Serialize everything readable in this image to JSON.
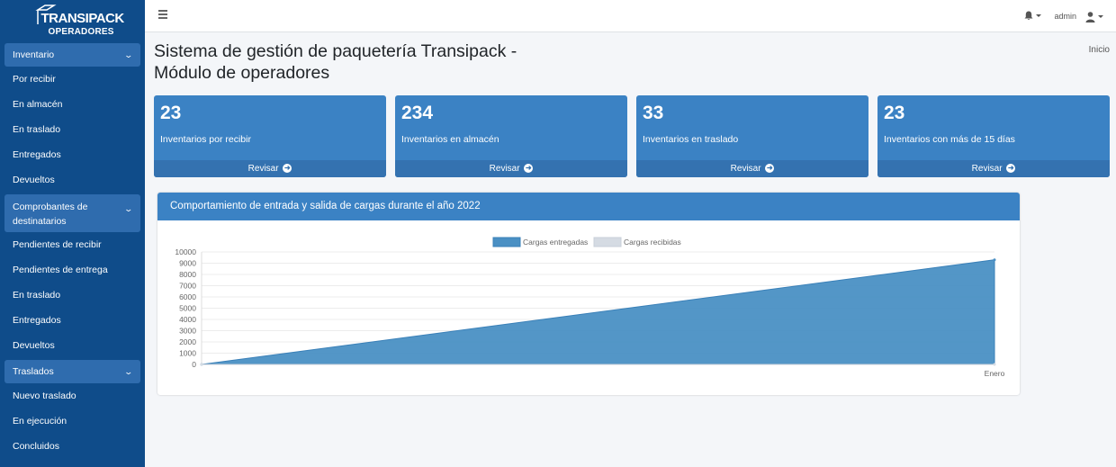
{
  "brand": {
    "line1": "TRANSIPACK",
    "line2": "OPERADORES"
  },
  "sidebar": {
    "sections": [
      {
        "label": "Inventario",
        "items": [
          "Por recibir",
          "En almacén",
          "En traslado",
          "Entregados",
          "Devueltos"
        ]
      },
      {
        "label": "Comprobantes de destinatarios",
        "items": [
          "Pendientes de recibir",
          "Pendientes de entrega",
          "En traslado",
          "Entregados",
          "Devueltos"
        ]
      },
      {
        "label": "Traslados",
        "items": [
          "Nuevo traslado",
          "En ejecución",
          "Concluidos"
        ]
      }
    ]
  },
  "topbar": {
    "user": "admin"
  },
  "page": {
    "title": "Sistema de gestión de paquetería Transipack - Módulo de operadores",
    "breadcrumb": "Inicio"
  },
  "cards": [
    {
      "value": "23",
      "label": "Inventarios por recibir",
      "action": "Revisar"
    },
    {
      "value": "234",
      "label": "Inventarios en almacén",
      "action": "Revisar"
    },
    {
      "value": "33",
      "label": "Inventarios en traslado",
      "action": "Revisar"
    },
    {
      "value": "23",
      "label": "Inventarios con más de 15 días",
      "action": "Revisar"
    }
  ],
  "colors": {
    "sidebar": "#0f4c8a",
    "accent": "#3b82c4",
    "series1": "#4a90c4",
    "series2": "#d5dbe3"
  },
  "chart_title": "Comportamiento de entrada y salida de cargas durante el año 2022",
  "chart_data": {
    "type": "area",
    "title": "Comportamiento de entrada y salida de cargas durante el año 2022",
    "x": [
      "",
      "Enero"
    ],
    "yticks": [
      0,
      1000,
      2000,
      3000,
      4000,
      5000,
      6000,
      7000,
      8000,
      9000,
      10000
    ],
    "ylim": [
      0,
      10000
    ],
    "legend": "top",
    "grid": true,
    "series": [
      {
        "name": "Cargas entregadas",
        "values": [
          0,
          9300
        ]
      },
      {
        "name": "Cargas recibidas",
        "values": [
          0,
          0
        ]
      }
    ]
  }
}
